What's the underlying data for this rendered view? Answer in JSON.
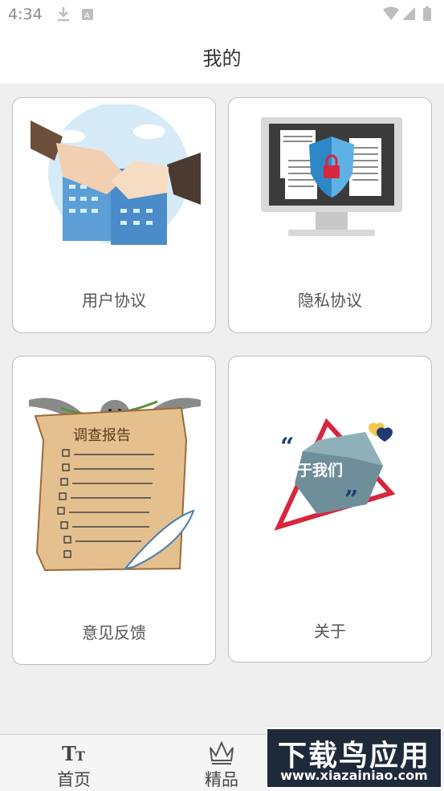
{
  "status": {
    "time": "4:34"
  },
  "header": {
    "title": "我的"
  },
  "cards": {
    "agreement": {
      "label": "用户协议"
    },
    "privacy": {
      "label": "隐私协议"
    },
    "feedback": {
      "label": "意见反馈",
      "image_text": "调查报告"
    },
    "about": {
      "label": "关于",
      "image_text": "关于我们"
    }
  },
  "nav": {
    "home": {
      "label": "首页",
      "icon": "text-size-icon"
    },
    "featured": {
      "label": "精品",
      "icon": "crown-icon"
    }
  },
  "watermark": {
    "title": "下载鸟应用",
    "url": "www.xiazainiao.com"
  },
  "colors": {
    "accent_red": "#d7263d",
    "navy": "#1f3b73",
    "page_bg": "#efefef"
  }
}
